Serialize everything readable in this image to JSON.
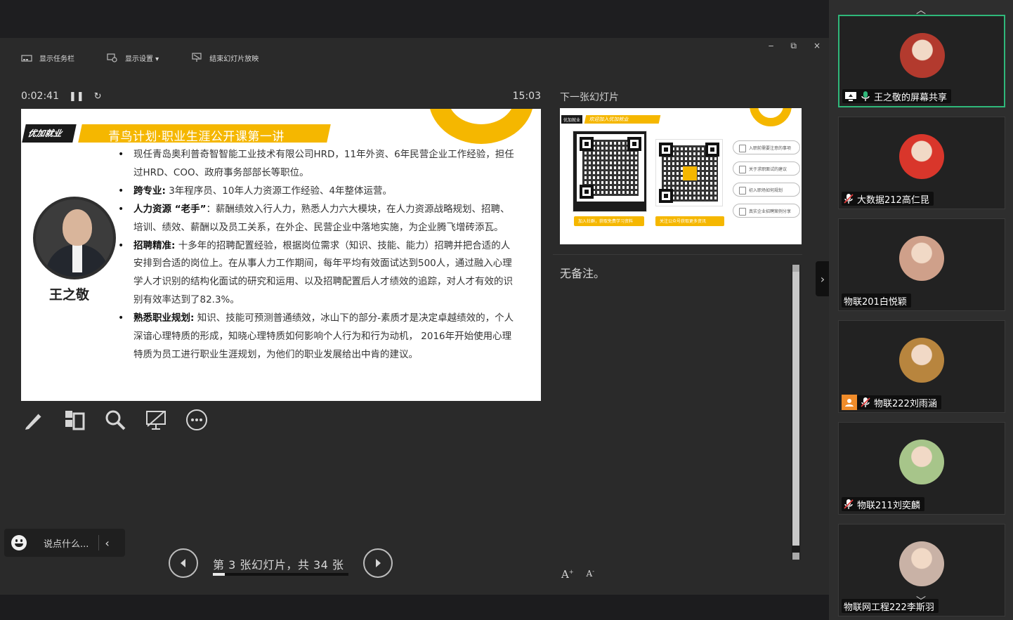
{
  "toolbar": {
    "show_taskbar": "显示任务栏",
    "display_settings": "显示设置 ▾",
    "end_slideshow": "结束幻灯片放映"
  },
  "window": {
    "minimize": "‒",
    "restore": "⧉",
    "close": "×"
  },
  "presenter": {
    "elapsed_time": "0:02:41",
    "clock": "15:03",
    "next_slide_label": "下一张幻灯片",
    "notes": "无备注。",
    "slide_counter": "第 3 张幻灯片，共 34 张",
    "current_slide_number": 3,
    "total_slides": 34
  },
  "slide": {
    "brand": "优加就业",
    "title": "青鸟计划·职业生涯公开课第一讲",
    "speaker": "王之敬",
    "bullets": [
      {
        "head": "",
        "text": "现任青岛奥利普奇智智能工业技术有限公司HRD，11年外资、6年民营企业工作经验，担任过HRD、COO、政府事务部部长等职位。"
      },
      {
        "head": "跨专业:",
        "text": " 3年程序员、10年人力资源工作经验、4年整体运营。"
      },
      {
        "head": "人力资源 “老手”",
        "text": "：薪酬绩效入行人力，熟悉人力六大模块，在人力资源战略规划、招聘、培训、绩效、薪酬以及员工关系，在外企、民营企业中落地实施，为企业腾飞增砖添瓦。"
      },
      {
        "head": "招聘精准:",
        "text": " 十多年的招聘配置经验，根据岗位需求（知识、技能、能力）招聘并把合适的人安排到合适的岗位上。在从事人力工作期间，每年平均有效面试达到500人，通过融入心理学人才识别的结构化面试的研究和运用、以及招聘配置后人才绩效的追踪，对人才有效的识别有效率达到了82.3%。"
      },
      {
        "head": "熟悉职业规划:",
        "text": " 知识、技能可预测普通绩效，冰山下的部分-素质才是决定卓越绩效的，个人深谙心理特质的形成，知晓心理特质如何影响个人行为和行为动机， 2016年开始使用心理特质为员工进行职业生涯规划，为他们的职业发展给出中肯的建议。"
      }
    ]
  },
  "next_slide": {
    "brand": "优加就业",
    "banner": "欢迎加入优加就业",
    "qr_button_1": "加入社群，获取免费学习资料",
    "qr_button_2": "关注公众号获取更多资讯",
    "links": [
      "入职前需要注意的事项",
      "关于求职面试的建议",
      "初入职场如何规划",
      "真实企业招聘案例分享"
    ]
  },
  "chat": {
    "placeholder": "说点什么..."
  },
  "participants": [
    {
      "name": "王之敬的屏幕共享",
      "sharing": true,
      "mic": "on",
      "active": true,
      "avatar_color": "#b33a2e"
    },
    {
      "name": "大数据212高仁昆",
      "sharing": false,
      "mic": "muted",
      "active": false,
      "avatar_color": "#d9362b"
    },
    {
      "name": "物联201白悦颖",
      "sharing": false,
      "mic": "none",
      "active": false,
      "avatar_color": "#cfa08a"
    },
    {
      "name": "物联222刘雨涵",
      "sharing": false,
      "mic": "muted",
      "active": false,
      "avatar_color": "#b8853e",
      "badge": true
    },
    {
      "name": "物联211刘奕麟",
      "sharing": false,
      "mic": "muted",
      "active": false,
      "avatar_color": "#a7c58a"
    },
    {
      "name": "物联网工程222李斯羽",
      "sharing": false,
      "mic": "none",
      "active": false,
      "avatar_color": "#c9b2a6"
    }
  ],
  "colors": {
    "accent_yellow": "#f5b700",
    "active_green": "#2fb87a",
    "background": "#2a2a2a"
  },
  "icons": [
    "taskbar-icon",
    "display-settings-icon",
    "end-slideshow-icon",
    "pause-icon",
    "reset-icon",
    "pen-icon",
    "all-slides-icon",
    "zoom-icon",
    "screen-icon",
    "more-icon",
    "emoji-icon",
    "chevron-left-icon",
    "prev-slide-icon",
    "next-slide-icon",
    "font-increase-icon",
    "font-decrease-icon",
    "mic-icon",
    "mic-muted-icon",
    "screen-share-icon"
  ]
}
